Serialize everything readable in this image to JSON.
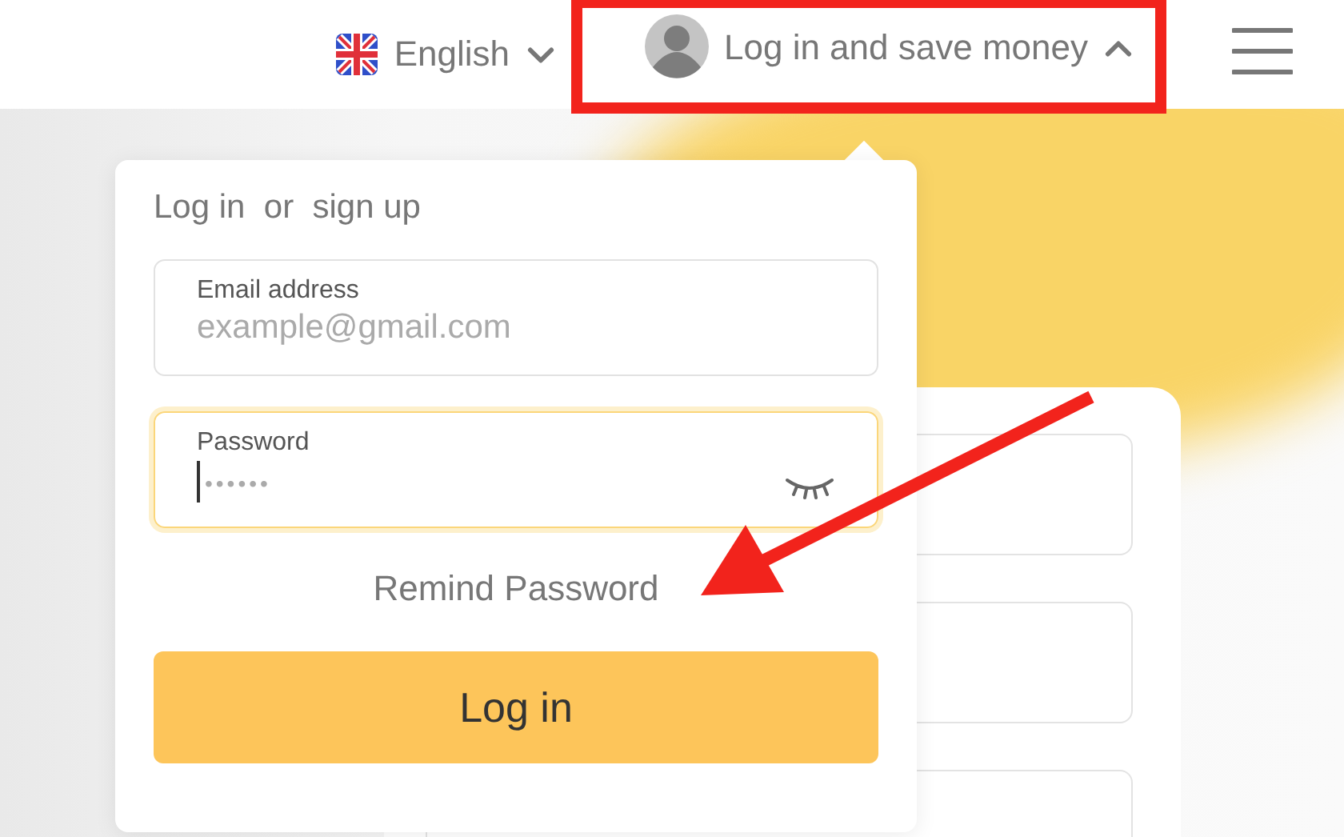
{
  "header": {
    "language": {
      "label": "English",
      "expanded": false
    },
    "account": {
      "label": "Log in and save money",
      "expanded": true
    }
  },
  "login_popup": {
    "title": "Log in  or  sign up",
    "fields": [
      {
        "kind": "text",
        "label": "Email address",
        "placeholder": "example@gmail.com",
        "focused": false
      },
      {
        "kind": "password",
        "label": "Password",
        "placeholder": "••••••",
        "focused": true
      }
    ],
    "remind_link": "Remind Password",
    "submit_button": "Log in"
  }
}
